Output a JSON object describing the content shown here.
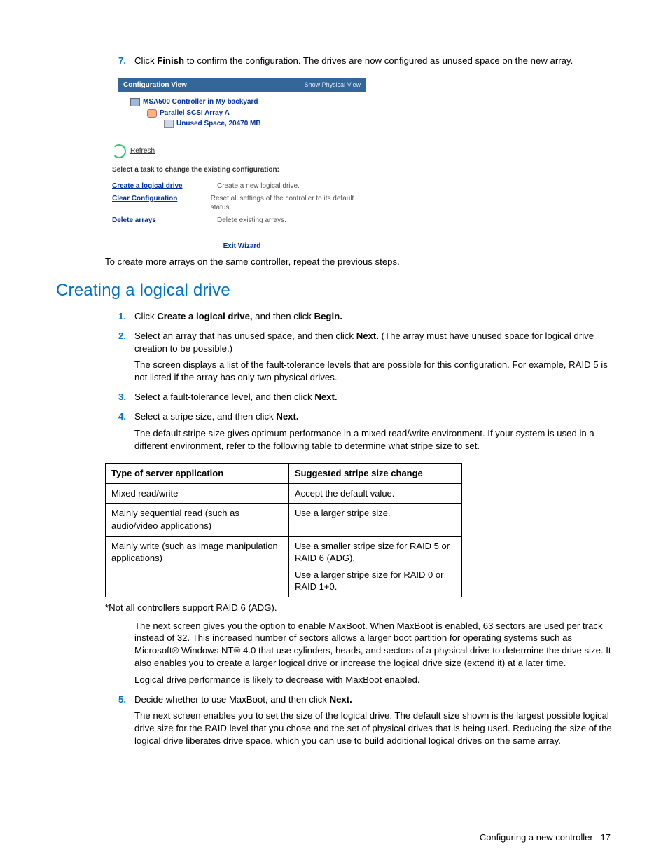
{
  "step7": {
    "num": "7.",
    "text_a": "Click ",
    "bold_a": "Finish",
    "text_b": " to confirm the configuration. The drives are now configured as unused space on the new array."
  },
  "figure": {
    "header_left": "Configuration View",
    "header_right": "Show Physical View",
    "tree": {
      "l1": "MSA500 Controller in My backyard",
      "l2": "Parallel SCSI Array A",
      "l3": "Unused Space, 20470 MB"
    },
    "refresh": "Refresh",
    "task_header": "Select a task to change the existing configuration:",
    "tasks": [
      {
        "label": "Create a logical drive",
        "desc": "Create a new logical drive."
      },
      {
        "label": "Clear Configuration",
        "desc": "Reset all settings of the controller to its default status."
      },
      {
        "label": "Delete arrays",
        "desc": "Delete existing arrays."
      }
    ],
    "exit": "Exit Wizard"
  },
  "after_figure": "To create more arrays on the same controller, repeat the previous steps.",
  "heading": "Creating a logical drive",
  "steps": {
    "s1": {
      "num": "1.",
      "a": "Click ",
      "b1": "Create a logical drive,",
      "c": " and then click ",
      "b2": "Begin."
    },
    "s2": {
      "num": "2.",
      "a": "Select an array that has unused space, and then click ",
      "b": "Next.",
      "c": " (The array must have unused space for logical drive creation to be possible.)",
      "p2": "The screen displays a list of the fault-tolerance levels that are possible for this configuration. For example, RAID 5 is not listed if the array has only two physical drives."
    },
    "s3": {
      "num": "3.",
      "a": "Select a fault-tolerance level, and then click ",
      "b": "Next."
    },
    "s4": {
      "num": "4.",
      "a": "Select a stripe size, and then click ",
      "b": "Next.",
      "p2": "The default stripe size gives optimum performance in a mixed read/write environment. If your system is used in a different environment, refer to the following table to determine what stripe size to set."
    },
    "s5": {
      "num": "5.",
      "a": "Decide whether to use MaxBoot, and then click ",
      "b": "Next.",
      "p2": "The next screen enables you to set the size of the logical drive. The default size shown is the largest possible logical drive size for the RAID level that you chose and the set of physical drives that is being used. Reducing the size of the logical drive liberates drive space, which you can use to build additional logical drives on the same array."
    }
  },
  "table": {
    "h1": "Type of server application",
    "h2": "Suggested stripe size change",
    "rows": [
      {
        "c1": "Mixed read/write",
        "c2a": "Accept the default value."
      },
      {
        "c1": "Mainly sequential read (such as audio/video applications)",
        "c2a": "Use a larger stripe size."
      },
      {
        "c1": "Mainly write (such as image manipulation applications)",
        "c2a": "Use a smaller stripe size for RAID 5 or RAID 6 (ADG).",
        "c2b": "Use a larger stripe size for RAID 0 or RAID 1+0."
      }
    ]
  },
  "table_note": "*Not all controllers support RAID 6 (ADG).",
  "maxboot_p1": "The next screen gives you the option to enable MaxBoot. When MaxBoot is enabled, 63 sectors are used per track instead of 32. This increased number of sectors allows a larger boot partition for operating systems such as Microsoft® Windows NT® 4.0 that use cylinders, heads, and sectors of a physical drive to determine the drive size. It also enables you to create a larger logical drive or increase the logical drive size (extend it) at a later time.",
  "maxboot_p2": "Logical drive performance is likely to decrease with MaxBoot enabled.",
  "footer": {
    "text": "Configuring a new controller",
    "page": "17"
  }
}
